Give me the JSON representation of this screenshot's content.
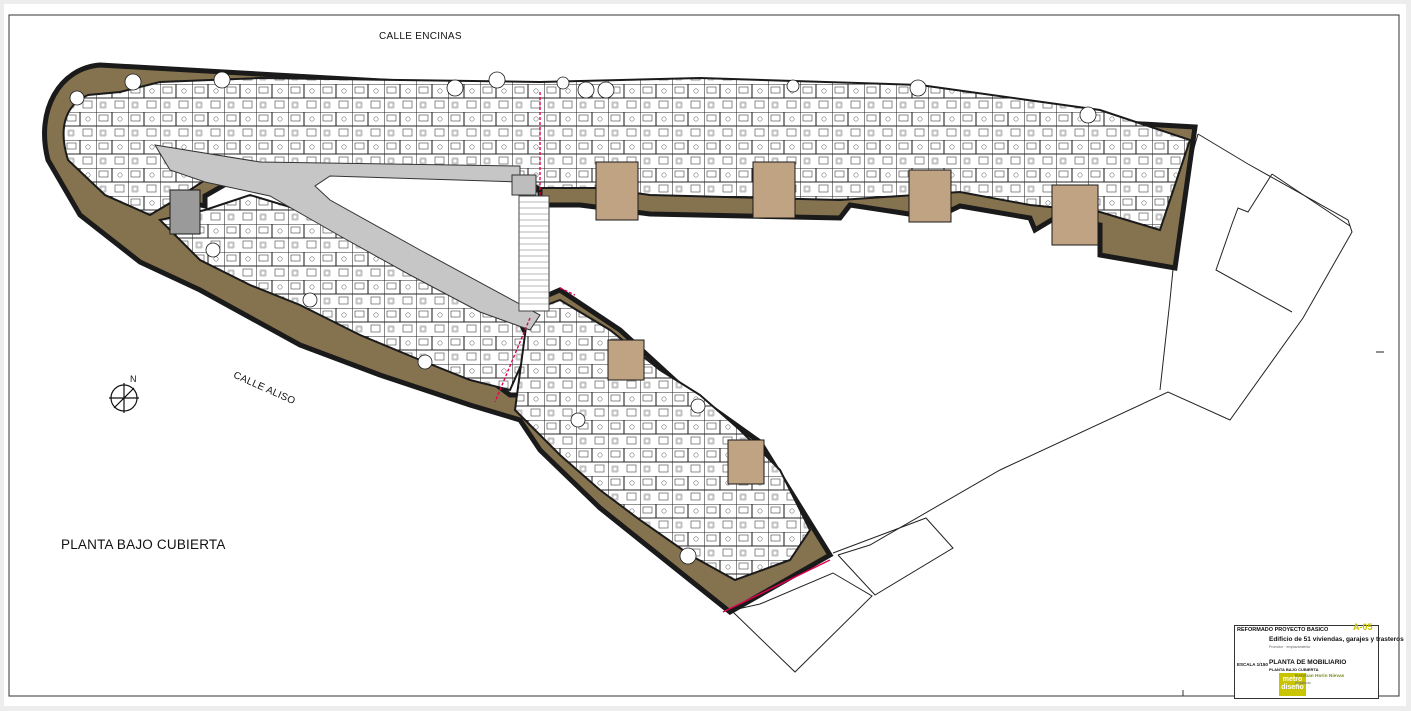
{
  "streets": {
    "top": "CALLE ENCINAS",
    "left": "CALLE ALISO"
  },
  "plan_title": "PLANTA BAJO CUBIERTA",
  "north_arrow": {
    "letter": "N",
    "icon": "north-arrow-icon"
  },
  "title_block": {
    "doc_type": "REFORMADO PROYECTO BASICO",
    "code": "A-05",
    "project_title": "Edificio de 51 viviendas, garajes y trasteros",
    "sub_info": "Promotor · emplazamiento",
    "scale": "ESCALA 1/150",
    "plan_title": "PLANTA DE MOBILIARIO",
    "plan_subtitle": "PLANTA BAJO CUBIERTA",
    "architect": "Esteban Horin Nievas",
    "role": "Arquitecto",
    "logo_line1": "metro",
    "logo_line2": "diseño"
  },
  "colors": {
    "terrace": "#857350",
    "wall": "#1a1a1a",
    "corridor": "#c6c6c6",
    "stair": "#c0a382",
    "accent_line": "#e2004e",
    "background": "#ffffff",
    "outer_frame": "#ededed"
  }
}
